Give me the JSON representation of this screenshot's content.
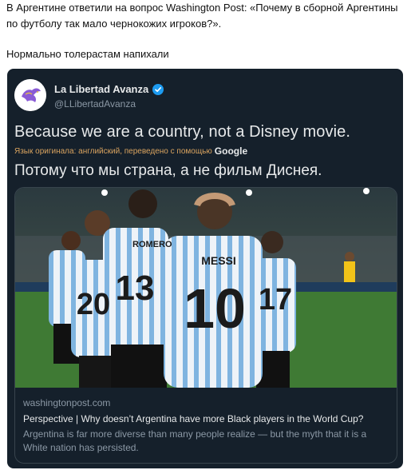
{
  "post": {
    "line1": "В Аргентине ответили на вопрос Washington Post: «Почему в сборной Аргентины",
    "line2": "по футболу так мало чернокожих игроков?».",
    "line3": "Нормально толерастам напихали"
  },
  "tweet": {
    "display_name": "La Libertad Avanza",
    "handle": "@LLibertadAvanza",
    "text_original": "Because we are a country, not a Disney movie.",
    "translation_note": "Язык оригинала: английский, переведено с помощью",
    "translation_provider": "Google",
    "text_translated": "Потому что мы страна, а не фильм Диснея.",
    "colors": {
      "background": "#15202b",
      "verified": "#1d9bf0",
      "note": "#d9a35f"
    }
  },
  "link_card": {
    "photo_icon": "football-players-photo",
    "jersey_names": [
      "ROMERO",
      "MESSI"
    ],
    "jersey_numbers": [
      "13",
      "10",
      "20",
      "17"
    ],
    "domain": "washingtonpost.com",
    "title": "Perspective | Why doesn’t Argentina have more Black players in the World Cup?",
    "description": "Argentina is far more diverse than many people realize — but the myth that it is a White nation has persisted."
  }
}
